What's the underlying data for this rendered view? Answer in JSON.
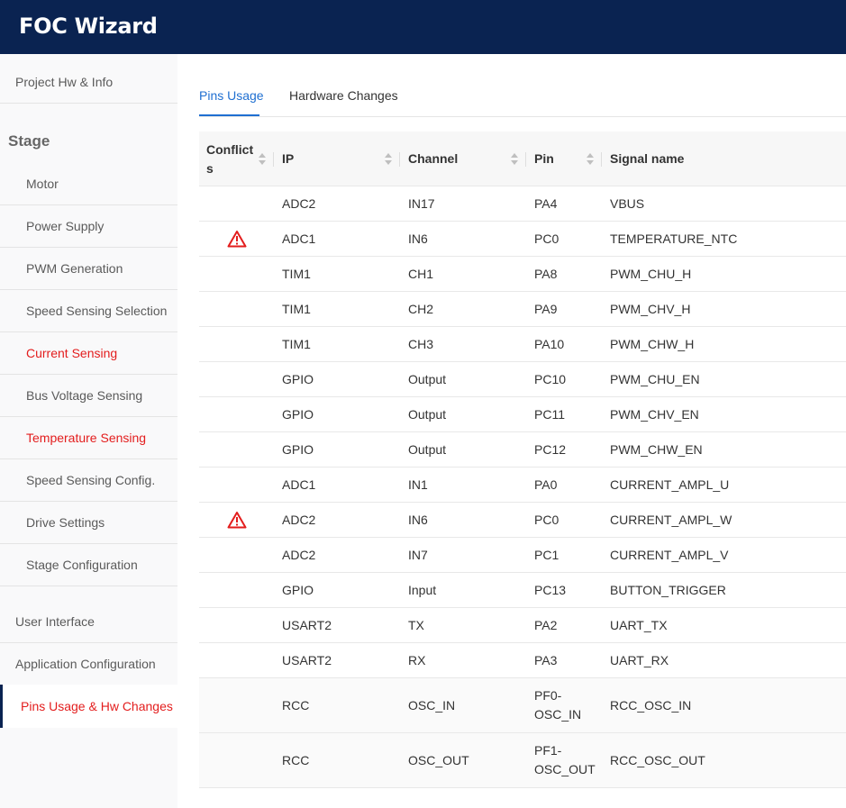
{
  "app": {
    "title": "FOC Wizard"
  },
  "sidebar": {
    "project_item": "Project Hw & Info",
    "stage_heading": "Stage",
    "stage_items": [
      {
        "label": "Motor",
        "highlight": false
      },
      {
        "label": "Power Supply",
        "highlight": false
      },
      {
        "label": "PWM Generation",
        "highlight": false
      },
      {
        "label": "Speed Sensing Selection",
        "highlight": false
      },
      {
        "label": "Current Sensing",
        "highlight": true
      },
      {
        "label": "Bus Voltage Sensing",
        "highlight": false
      },
      {
        "label": "Temperature Sensing",
        "highlight": true
      },
      {
        "label": "Speed Sensing Config.",
        "highlight": false
      },
      {
        "label": "Drive Settings",
        "highlight": false
      },
      {
        "label": "Stage Configuration",
        "highlight": false
      }
    ],
    "bottom_items": [
      {
        "label": "User Interface",
        "active": false
      },
      {
        "label": "Application Configuration",
        "active": false
      },
      {
        "label": "Pins Usage & Hw Changes",
        "active": true
      }
    ]
  },
  "tabs": [
    {
      "label": "Pins Usage",
      "active": true
    },
    {
      "label": "Hardware Changes",
      "active": false
    }
  ],
  "table": {
    "columns": [
      {
        "line1": "Conflict",
        "line2": "s"
      },
      {
        "line1": "IP"
      },
      {
        "line1": "Channel"
      },
      {
        "line1": "Pin"
      },
      {
        "line1": "Signal name"
      }
    ],
    "rows": [
      {
        "conflict": false,
        "ip": "ADC2",
        "channel": "IN17",
        "pin": "PA4",
        "signal": "VBUS"
      },
      {
        "conflict": true,
        "ip": "ADC1",
        "channel": "IN6",
        "pin": "PC0",
        "signal": "TEMPERATURE_NTC"
      },
      {
        "conflict": false,
        "ip": "TIM1",
        "channel": "CH1",
        "pin": "PA8",
        "signal": "PWM_CHU_H"
      },
      {
        "conflict": false,
        "ip": "TIM1",
        "channel": "CH2",
        "pin": "PA9",
        "signal": "PWM_CHV_H"
      },
      {
        "conflict": false,
        "ip": "TIM1",
        "channel": "CH3",
        "pin": "PA10",
        "signal": "PWM_CHW_H"
      },
      {
        "conflict": false,
        "ip": "GPIO",
        "channel": "Output",
        "pin": "PC10",
        "signal": "PWM_CHU_EN"
      },
      {
        "conflict": false,
        "ip": "GPIO",
        "channel": "Output",
        "pin": "PC11",
        "signal": "PWM_CHV_EN"
      },
      {
        "conflict": false,
        "ip": "GPIO",
        "channel": "Output",
        "pin": "PC12",
        "signal": "PWM_CHW_EN"
      },
      {
        "conflict": false,
        "ip": "ADC1",
        "channel": "IN1",
        "pin": "PA0",
        "signal": "CURRENT_AMPL_U"
      },
      {
        "conflict": true,
        "ip": "ADC2",
        "channel": "IN6",
        "pin": "PC0",
        "signal": "CURRENT_AMPL_W"
      },
      {
        "conflict": false,
        "ip": "ADC2",
        "channel": "IN7",
        "pin": "PC1",
        "signal": "CURRENT_AMPL_V"
      },
      {
        "conflict": false,
        "ip": "GPIO",
        "channel": "Input",
        "pin": "PC13",
        "signal": "BUTTON_TRIGGER"
      },
      {
        "conflict": false,
        "ip": "USART2",
        "channel": "TX",
        "pin": "PA2",
        "signal": "UART_TX"
      },
      {
        "conflict": false,
        "ip": "USART2",
        "channel": "RX",
        "pin": "PA3",
        "signal": "UART_RX"
      },
      {
        "conflict": false,
        "ip": "RCC",
        "channel": "OSC_IN",
        "pin_line1": "PF0-",
        "pin_line2": "OSC_IN",
        "signal": "RCC_OSC_IN"
      },
      {
        "conflict": false,
        "ip": "RCC",
        "channel": "OSC_OUT",
        "pin_line1": "PF1-",
        "pin_line2": "OSC_OUT",
        "signal": "RCC_OSC_OUT"
      }
    ]
  },
  "colors": {
    "header_bg": "#0a2351",
    "accent_blue": "#1f6fd1",
    "highlight_red": "#e31d1d",
    "warning_red": "#e31d1d"
  },
  "icons": {
    "conflict": "warning-triangle-icon",
    "sort": "sort-caret-icon"
  }
}
